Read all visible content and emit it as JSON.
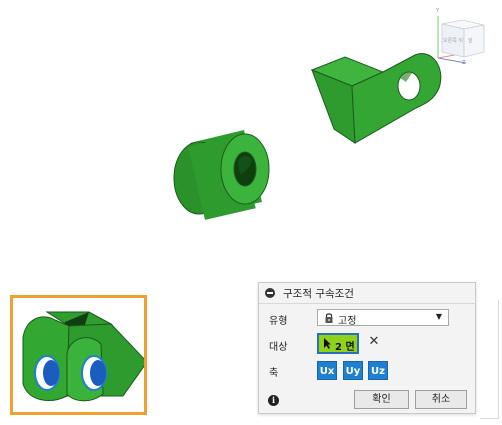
{
  "viewcube": {
    "axis_y": "Y",
    "axis_z": "Z",
    "face_left": "오른쪽 뒤",
    "face_right": "앞"
  },
  "dialog": {
    "title": "구조적 구속조건",
    "type_label": "유형",
    "type_value": "고정",
    "target_label": "대상",
    "target_selection": "2 면",
    "axis_label": "축",
    "axis_buttons": [
      "Ux",
      "Uy",
      "Uz"
    ],
    "ok_label": "확인",
    "cancel_label": "취소"
  },
  "colors": {
    "model_green": "#2e9b2e",
    "dialog_bg": "#f3f3f3",
    "selection_green": "#8fd11b",
    "axis_blue": "#1f7fd0",
    "thumbnail_border": "#f0a030"
  }
}
